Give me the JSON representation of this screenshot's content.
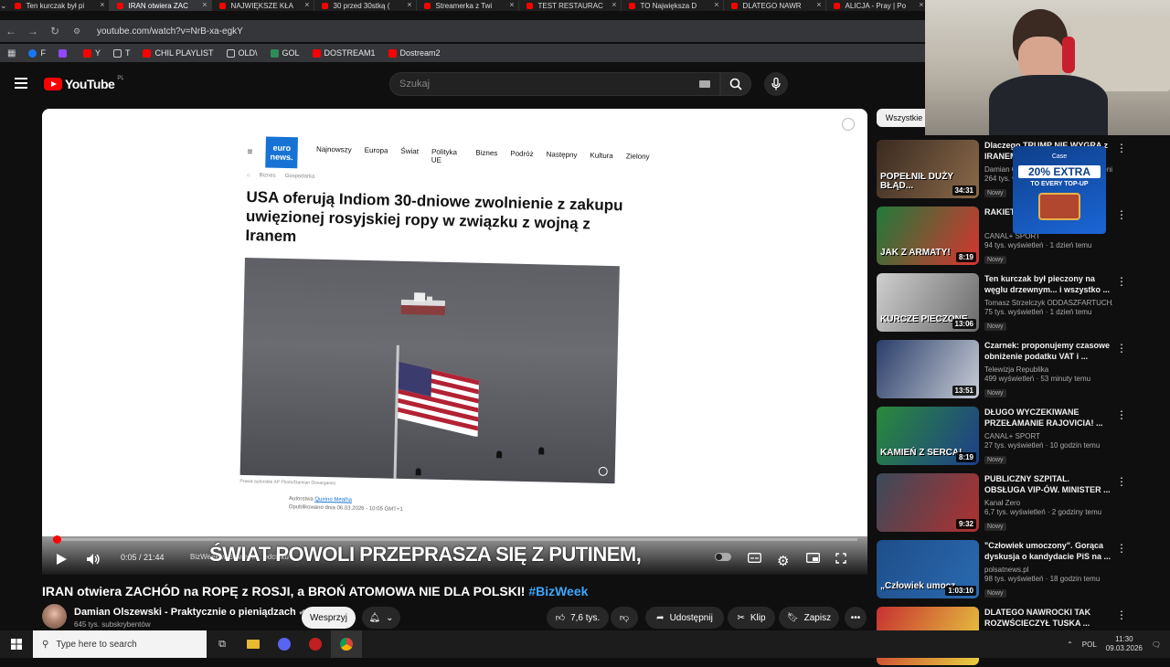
{
  "browser": {
    "tabs": [
      {
        "label": "Ten kurczak był pi",
        "active": false
      },
      {
        "label": "IRAN otwiera ZAC",
        "active": true
      },
      {
        "label": "NAJWIĘKSZE KŁA",
        "active": false
      },
      {
        "label": "30 przed 30stką (",
        "active": false
      },
      {
        "label": "Streamerka z Twi",
        "active": false
      },
      {
        "label": "TEST RESTAURAC",
        "active": false
      },
      {
        "label": "TO Największa D",
        "active": false
      },
      {
        "label": "DLATEGO NAWR",
        "active": false
      },
      {
        "label": "ALICJA - Pray | Po",
        "active": false
      }
    ],
    "url": "youtube.com/watch?v=NrB-xa-egkY",
    "bookmarks": [
      {
        "label": "F",
        "icon": "facebook-icon",
        "style": "blue"
      },
      {
        "label": "",
        "icon": "twitch-icon",
        "style": "purple"
      },
      {
        "label": "Y",
        "icon": "youtube-icon",
        "style": "red"
      },
      {
        "label": "T",
        "icon": "x-icon",
        "style": "gray"
      },
      {
        "label": "CHIL PLAYLIST",
        "icon": "youtube-icon",
        "style": "red"
      },
      {
        "label": "OLD\\",
        "icon": "folder-icon",
        "style": "gray"
      },
      {
        "label": "GOL",
        "icon": "gol-icon",
        "style": "green"
      },
      {
        "label": "DOSTREAM1",
        "icon": "youtube-icon",
        "style": "red"
      },
      {
        "label": "Dostream2",
        "icon": "youtube-icon",
        "style": "red"
      }
    ]
  },
  "youtube": {
    "logo_text": "YouTube",
    "logo_region": "PL",
    "search_placeholder": "Szukaj"
  },
  "article": {
    "logo_line1": "euro",
    "logo_line2": "news.",
    "nav": [
      "Najnowszy",
      "Europa",
      "Świat",
      "Polityka UE",
      "Biznes",
      "Podróż",
      "Następny",
      "Kultura",
      "Zielony"
    ],
    "breadcrumb": [
      "Biznes",
      "Gospodarka"
    ],
    "headline": "USA oferują Indiom 30-dniowe zwolnienie z zakupu uwięzionej rosyjskiej ropy w związku z wojną z Iranem",
    "caption": "Prawa autorskie AP Photo/Damian Dovarganes",
    "author_label": "Autorstwa",
    "author_name": "Quirino Mealha",
    "published": "Opublikowano dnia 06.03.2026 - 10:05 GMT+1"
  },
  "player": {
    "time": "0:05 / 21:44",
    "chapter": "BizWeek w Bizweek... odcinku ›",
    "subtitle": "ŚWIAT POWOLI PRZEPRASZA SIĘ Z PUTINEM,",
    "progress_fraction": 0.004
  },
  "video": {
    "title": "IRAN otwiera ZACHÓD na ROPĘ z ROSJI, a BROŃ ATOMOWA NIE DLA POLSKI!",
    "hashtag": "#BizWeek",
    "channel": "Damian Olszewski - Praktycznie o pieniądzach",
    "subscribers": "645 tys. subskrybentów",
    "support_label": "Wesprzyj",
    "likes": "7,6 tys.",
    "share_label": "Udostępnij",
    "clip_label": "Klip",
    "save_label": "Zapisz"
  },
  "sidebar": {
    "chip": "Wszystkie",
    "items": [
      {
        "title": "Dlaczego TRUMP NIE WYGRA z IRANEM",
        "channel": "Damian Olszewski - Praktycznie o pienią...",
        "meta": "264 tys. wyświetleń",
        "badge": "Nowy",
        "duration": "34:31",
        "thumb_text": "POPEŁNIŁ DUŻY BŁĄD...",
        "colors": [
          "#3a2a20",
          "#8a6a4a"
        ]
      },
      {
        "title": "RAKIETA... ZWYCIĘ...",
        "channel": "CANAL+ SPORT",
        "meta": "94 tys. wyświetleń · 1 dzień temu",
        "badge": "Nowy",
        "duration": "8:19",
        "thumb_text": "JAK Z ARMATY!",
        "colors": [
          "#1f7a3a",
          "#d8342f"
        ]
      },
      {
        "title": "Ten kurczak był pieczony na węglu drzewnym... i wszystko ...",
        "channel": "Tomasz Strzelczyk ODDASZFARTUCHA",
        "meta": "75 tys. wyświetleń · 1 dzień temu",
        "badge": "Nowy",
        "duration": "13:06",
        "thumb_text": "KURCZE PIECZONE",
        "colors": [
          "#cfcfcf",
          "#6a6a6a"
        ]
      },
      {
        "title": "Czarnek: proponujemy czasowe obniżenie podatku VAT i ...",
        "channel": "Telewizja Republika",
        "meta": "499 wyświetleń · 53 minuty temu",
        "badge": "Nowy",
        "duration": "13:51",
        "thumb_text": "",
        "colors": [
          "#2a3e6a",
          "#c9cdd6"
        ]
      },
      {
        "title": "DŁUGO WYCZEKIWANE PRZEŁAMANIE RAJOVICIA! ...",
        "channel": "CANAL+ SPORT",
        "meta": "27 tys. wyświetleń · 10 godzin temu",
        "badge": "Nowy",
        "duration": "8:19",
        "thumb_text": "KAMIEŃ Z SERCA!",
        "colors": [
          "#2a8a3a",
          "#1e3e8a"
        ]
      },
      {
        "title": "PUBLICZNY SZPITAL. OBSŁUGA VIP-ÓW. MINISTER ...",
        "channel": "Kanał Zero",
        "meta": "6,7 tys. wyświetleń · 2 godziny temu",
        "badge": "Nowy",
        "duration": "9:32",
        "thumb_text": "",
        "colors": [
          "#3a4a5a",
          "#b03030"
        ]
      },
      {
        "title": "\"Człowiek umoczony\". Gorąca dyskusja o kandydacie PiS na ...",
        "channel": "polsatnews.pl",
        "meta": "98 tys. wyświetleń · 18 godzin temu",
        "badge": "Nowy",
        "duration": "1:03:10",
        "thumb_text": "„Człowiek umocz",
        "colors": [
          "#1e4e8a",
          "#2a6ab0"
        ]
      },
      {
        "title": "DLATEGO NAWROCKI TAK ROZWŚCIECZYŁ TUSKA ...",
        "channel": "",
        "meta": "",
        "badge": "",
        "duration": "",
        "thumb_text": "",
        "colors": [
          "#c83030",
          "#e8d040"
        ]
      }
    ]
  },
  "ad": {
    "brand": "Case",
    "line1": "20% EXTRA",
    "line2": "TO EVERY TOP-UP"
  },
  "taskbar": {
    "search_placeholder": "Type here to search",
    "lang": "POL",
    "time": "11:30",
    "date": "09.03.2026"
  }
}
